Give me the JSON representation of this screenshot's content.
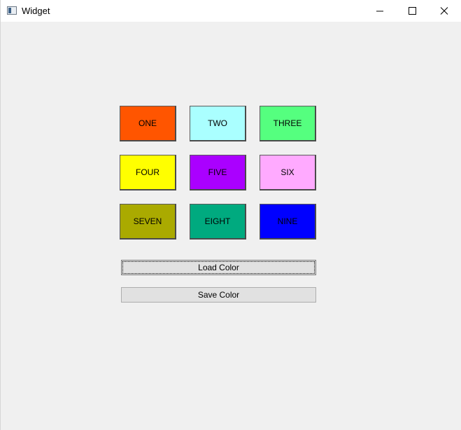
{
  "window": {
    "title": "Widget"
  },
  "swatches": [
    {
      "label": "ONE",
      "color": "#ff5500"
    },
    {
      "label": "TWO",
      "color": "#aaffff"
    },
    {
      "label": "THREE",
      "color": "#55ff7f"
    },
    {
      "label": "FOUR",
      "color": "#ffff00"
    },
    {
      "label": "FIVE",
      "color": "#aa00ff"
    },
    {
      "label": "SIX",
      "color": "#ffaaff"
    },
    {
      "label": "SEVEN",
      "color": "#aaaa00"
    },
    {
      "label": "EIGHT",
      "color": "#00aa7f"
    },
    {
      "label": "NINE",
      "color": "#0000ff"
    }
  ],
  "actions": {
    "load_label": "Load Color",
    "save_label": "Save Color"
  },
  "icons": {
    "app": "app-window-icon",
    "minimize": "minimize-icon",
    "maximize": "maximize-icon",
    "close": "close-icon"
  }
}
